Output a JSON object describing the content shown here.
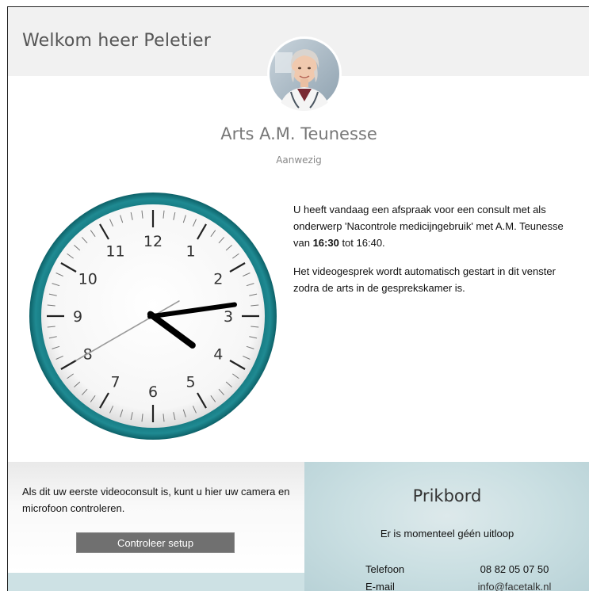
{
  "header": {
    "welcome": "Welkom heer Peletier"
  },
  "doctor": {
    "name": "Arts A.M. Teunesse",
    "status": "Aanwezig"
  },
  "clock": {
    "hours": 4,
    "minutes": 13,
    "seconds": 40,
    "face_color": "#1b7f86"
  },
  "appointment": {
    "line1_prefix": "U heeft vandaag een afspraak voor een consult met als onderwerp 'Nacontrole medicijngebruik' met A.M. Teunesse van ",
    "start_time": "16:30",
    "line1_mid": " tot ",
    "end_time": "16:40.",
    "line2": "Het videogesprek wordt automatisch gestart in dit venster zodra de arts in de gesprekskamer is."
  },
  "setup": {
    "text": "Als dit uw eerste videoconsult is, kunt u hier uw camera en microfoon controleren.",
    "button_label": "Controleer setup"
  },
  "prikbord": {
    "title": "Prikbord",
    "delay_text": "Er is momenteel géén uitloop",
    "phone_label": "Telefoon",
    "phone_value": "08 82 05 07 50",
    "email_label": "E-mail",
    "email_value": "info@facetalk.nl"
  }
}
